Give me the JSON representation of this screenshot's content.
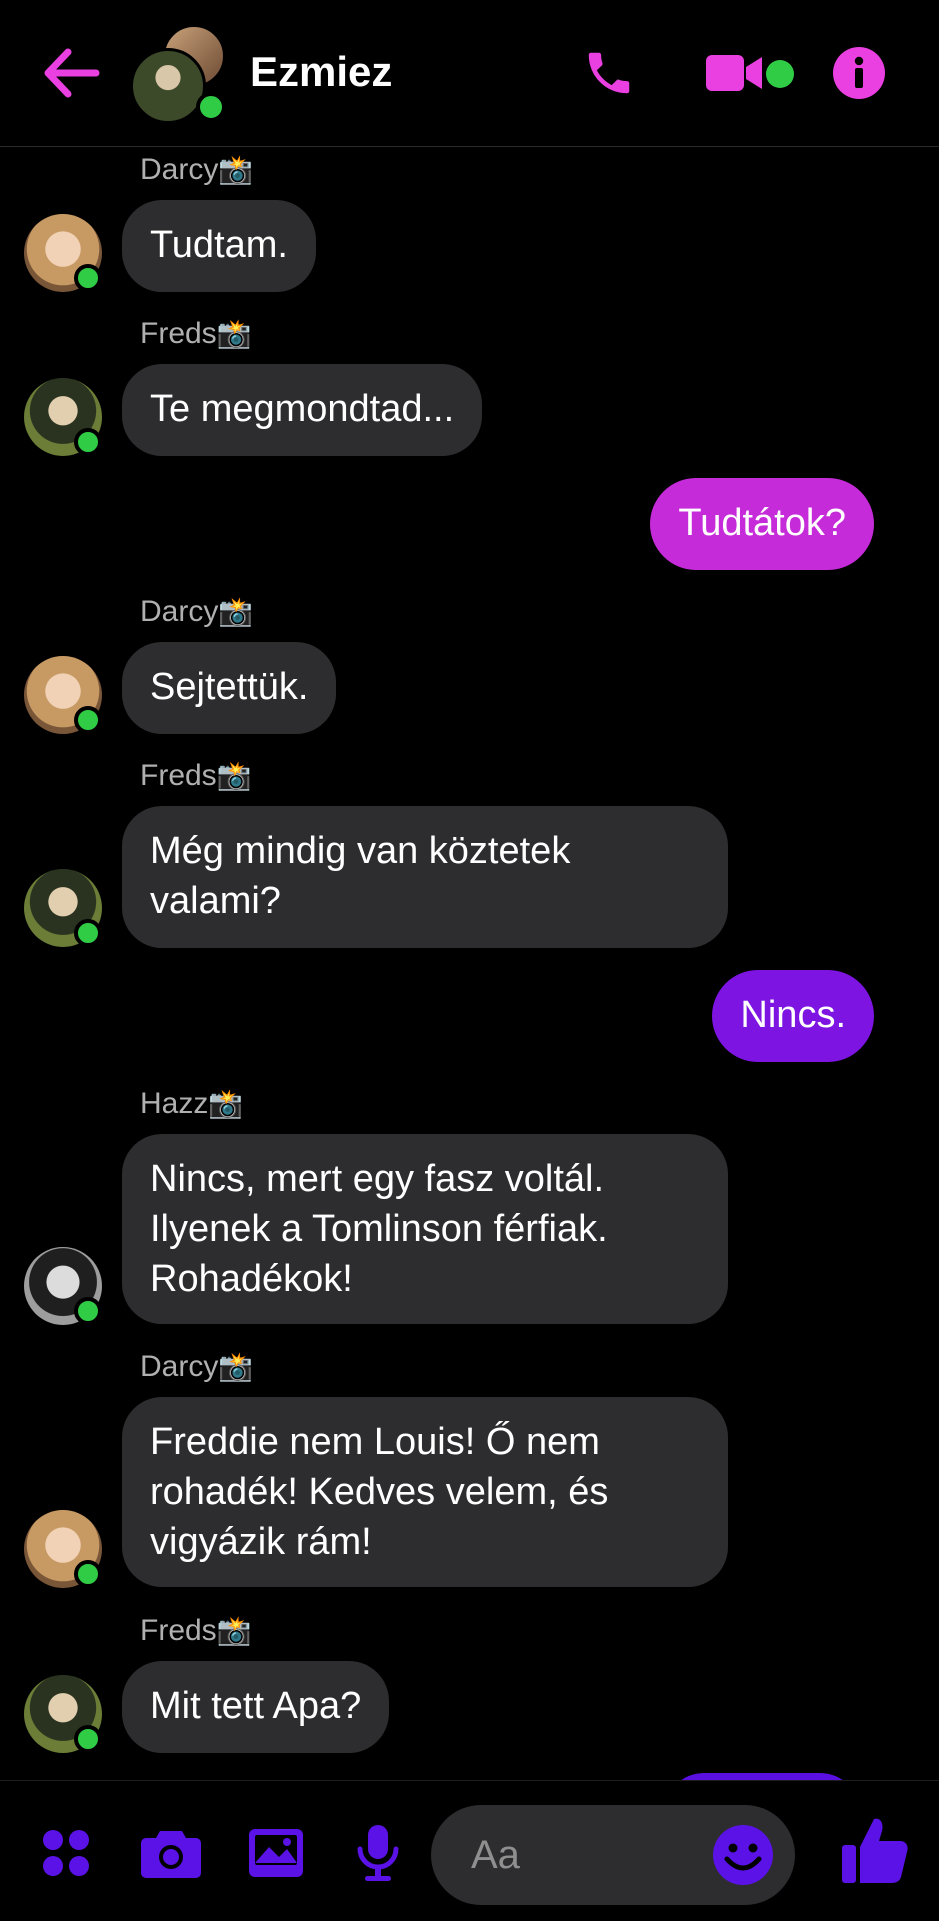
{
  "header": {
    "title": "Ezmiez",
    "icons": {
      "back": "arrow-left-icon",
      "call": "phone-icon",
      "video": "video-camera-icon",
      "info": "info-icon"
    }
  },
  "messages": [
    {
      "sender": "Darcy",
      "sender_emoji": "📸",
      "text": "Tudtam."
    },
    {
      "sender": "Freds",
      "sender_emoji": "📸",
      "text": "Te megmondtad..."
    },
    {
      "text": "Tudtátok?"
    },
    {
      "sender": "Darcy",
      "sender_emoji": "📸",
      "text": "Sejtettük."
    },
    {
      "sender": "Freds",
      "sender_emoji": "📸",
      "text": "Még mindig van köztetek\nvalami?"
    },
    {
      "text": "Nincs."
    },
    {
      "sender": "Hazz",
      "sender_emoji": "📸",
      "text": "Nincs, mert egy fasz voltál.\nIlyenek a Tomlinson férfiak.\nRohadékok!"
    },
    {
      "sender": "Darcy",
      "sender_emoji": "📸",
      "text": "Freddie nem Louis! Ő nem\nrohadék! Kedves velem, és\nvigyázik rám!"
    },
    {
      "sender": "Freds",
      "sender_emoji": "📸",
      "text": "Mit tett Apa?"
    }
  ],
  "composer": {
    "placeholder": "Aa",
    "icons": [
      "apps-grid-icon",
      "camera-icon",
      "image-icon",
      "microphone-icon",
      "emoji-icon",
      "thumbs-up-icon"
    ]
  },
  "colors": {
    "accent_pink": "#ea3fe1",
    "accent_purple": "#5a12e6",
    "online_green": "#31cc46",
    "bubble_incoming": "#2d2d2f",
    "bubble_outgoing_1": "#c62bd9",
    "bubble_outgoing_2": "#7d14e2"
  }
}
